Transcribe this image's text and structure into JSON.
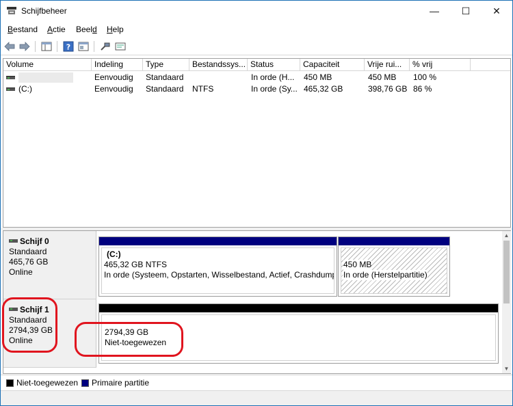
{
  "window": {
    "title": "Schijfbeheer",
    "minimize": "—",
    "maximize": "☐",
    "close": "✕"
  },
  "menu": [
    {
      "key": "B",
      "rest": "estand"
    },
    {
      "key": "A",
      "rest": "ctie"
    },
    {
      "key": "",
      "rest": "Beeld",
      "underline_last": "d"
    },
    {
      "key": "H",
      "rest": "elp"
    }
  ],
  "toolbar": {
    "icons": [
      "back-arrow-icon",
      "forward-arrow-icon",
      "console-tree-icon",
      "help-icon",
      "properties-icon",
      "connect-icon",
      "rescan-icon"
    ]
  },
  "list": {
    "columns": [
      "Volume",
      "Indeling",
      "Type",
      "Bestandssys...",
      "Status",
      "Capaciteit",
      "Vrije rui...",
      "% vrij"
    ],
    "rows": [
      [
        "",
        "Eenvoudig",
        "Standaard",
        "",
        "In orde (H...",
        "450 MB",
        "450 MB",
        "100 %"
      ],
      [
        "(C:)",
        "Eenvoudig",
        "Standaard",
        "NTFS",
        "In orde (Sy...",
        "465,32 GB",
        "398,76 GB",
        "86 %"
      ]
    ]
  },
  "disks": [
    {
      "name": "Schijf 0",
      "kind": "Standaard",
      "size": "465,76 GB",
      "state": "Online",
      "partitions": [
        {
          "title": "(C:)",
          "line1": "465,32 GB NTFS",
          "line2": "In orde (Systeem, Opstarten, Wisselbestand, Actief, Crashdump,"
        },
        {
          "title": "",
          "line1": "450 MB",
          "line2": "In orde (Herstelpartitie)"
        }
      ]
    },
    {
      "name": "Schijf 1",
      "kind": "Standaard",
      "size": "2794,39 GB",
      "state": "Online",
      "partitions": [
        {
          "title": "",
          "line1": "2794,39 GB",
          "line2": "Niet-toegewezen"
        }
      ]
    }
  ],
  "legend": [
    {
      "label": "Niet-toegewezen",
      "color": "#000000"
    },
    {
      "label": "Primaire partitie",
      "color": "#00007f"
    }
  ],
  "colors": {
    "primary_partition": "#00007f",
    "unallocated": "#000000",
    "annotation": "#e0141e"
  }
}
